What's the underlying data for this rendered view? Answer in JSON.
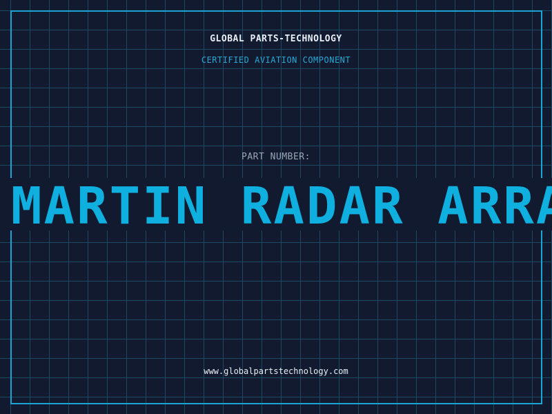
{
  "header": {
    "brand": "GLOBAL PARTS-TECHNOLOGY",
    "tagline": "CERTIFIED AVIATION COMPONENT"
  },
  "part": {
    "label": "PART NUMBER:",
    "value": "MARTIN RADAR ARRAY"
  },
  "footer": {
    "website": "www.globalpartstechnology.com"
  },
  "colors": {
    "background": "#111a2e",
    "grid": "#1d4a62",
    "accent": "#1aa5d6",
    "text": "#e8eef5",
    "muted": "#9aa6b8"
  }
}
